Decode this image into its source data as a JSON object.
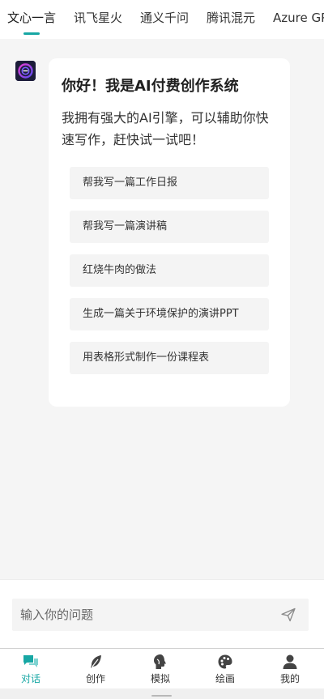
{
  "tabs": [
    {
      "label": "文心一言",
      "active": true
    },
    {
      "label": "讯飞星火"
    },
    {
      "label": "通义千问"
    },
    {
      "label": "腾讯混元"
    },
    {
      "label": "Azure GPT"
    }
  ],
  "colors": {
    "accent": "#17a7a4",
    "background": "#f5f5f5",
    "card": "#ffffff"
  },
  "chat": {
    "title": "你好！我是AI付费创作系统",
    "description": "我拥有强大的AI引擎，可以辅助你快速写作，赶快试一试吧！",
    "suggestions": [
      "帮我写一篇工作日报",
      "帮我写一篇演讲稿",
      "红烧牛肉的做法",
      "生成一篇关于环境保护的演讲PPT",
      "用表格形式制作一份课程表"
    ]
  },
  "input": {
    "placeholder": "输入你的问题",
    "value": ""
  },
  "nav": [
    {
      "label": "对话",
      "icon": "chat-bubbles-icon",
      "active": true
    },
    {
      "label": "创作",
      "icon": "feather-icon"
    },
    {
      "label": "模拟",
      "icon": "head-profile-icon"
    },
    {
      "label": "绘画",
      "icon": "palette-icon"
    },
    {
      "label": "我的",
      "icon": "user-icon"
    }
  ]
}
